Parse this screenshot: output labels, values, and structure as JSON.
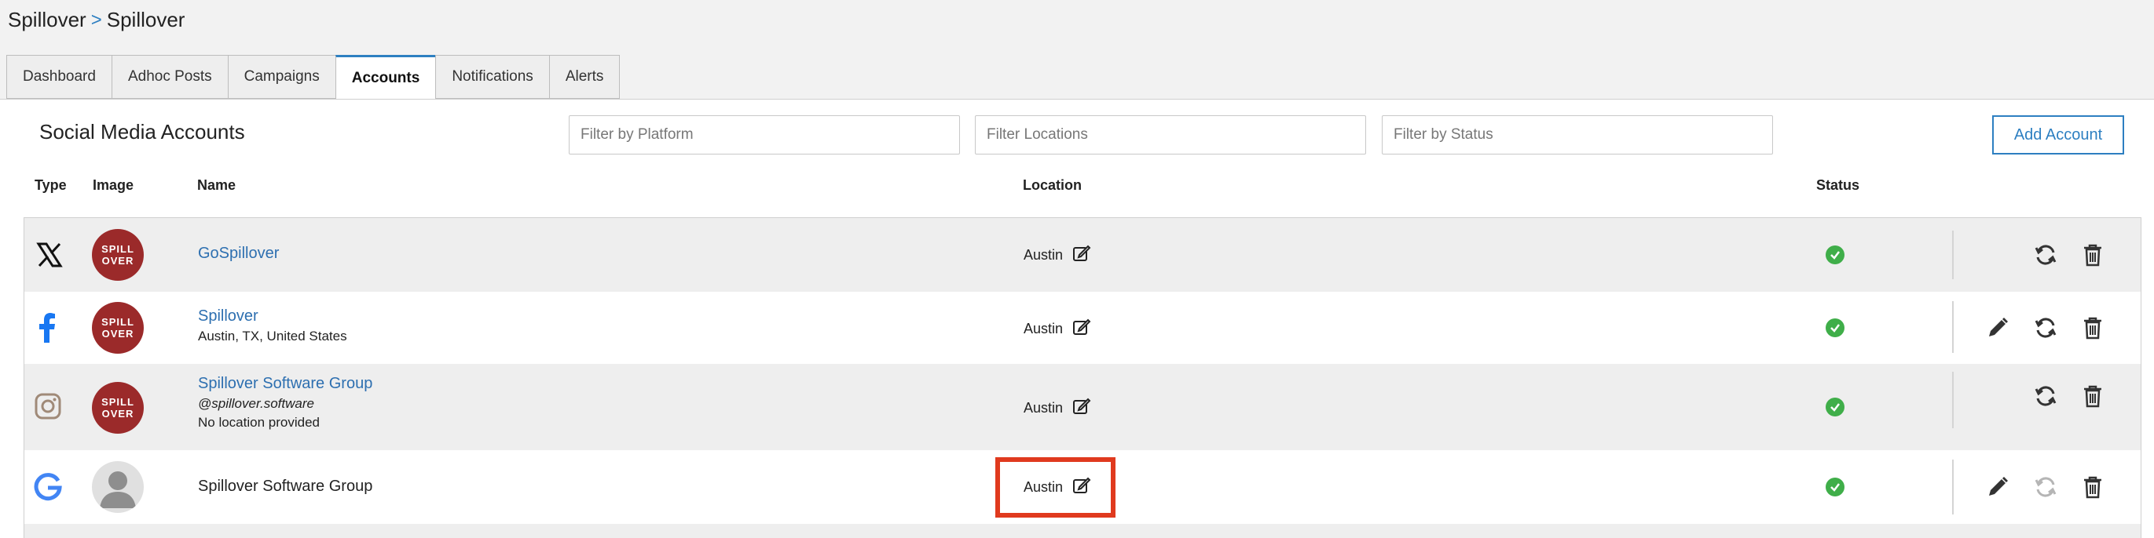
{
  "breadcrumb": {
    "parent": "Spillover",
    "separator": ">",
    "current": "Spillover"
  },
  "tabs": [
    {
      "label": "Dashboard",
      "active": false
    },
    {
      "label": "Adhoc Posts",
      "active": false
    },
    {
      "label": "Campaigns",
      "active": false
    },
    {
      "label": "Accounts",
      "active": true
    },
    {
      "label": "Notifications",
      "active": false
    },
    {
      "label": "Alerts",
      "active": false
    }
  ],
  "panel": {
    "title": "Social Media Accounts",
    "filters": {
      "platform_placeholder": "Filter by Platform",
      "locations_placeholder": "Filter Locations",
      "status_placeholder": "Filter by Status"
    },
    "add_button": "Add Account"
  },
  "table": {
    "headers": {
      "type": "Type",
      "image": "Image",
      "name": "Name",
      "location": "Location",
      "status": "Status"
    },
    "rows": [
      {
        "type_icon": "x-twitter-icon",
        "avatar": "spillover-logo",
        "avatar_text_1": "SPILL",
        "avatar_text_2": "OVER",
        "name": "GoSpillover",
        "line2": "",
        "line3": "",
        "location": "Austin",
        "status": "ok",
        "actions": [
          "refresh",
          "delete"
        ]
      },
      {
        "type_icon": "facebook-icon",
        "avatar": "spillover-logo",
        "avatar_text_1": "SPILL",
        "avatar_text_2": "OVER",
        "name": "Spillover",
        "line2": "Austin, TX, United States",
        "line3": "",
        "location": "Austin",
        "status": "ok",
        "actions": [
          "edit",
          "refresh",
          "delete"
        ]
      },
      {
        "type_icon": "instagram-icon",
        "avatar": "spillover-logo",
        "avatar_text_1": "SPILL",
        "avatar_text_2": "OVER",
        "name": "Spillover Software Group",
        "line2": "@spillover.software",
        "line3": "No location provided",
        "location": "Austin",
        "status": "ok",
        "actions": [
          "refresh",
          "delete"
        ]
      },
      {
        "type_icon": "google-icon",
        "avatar": "generic-user",
        "name": "Spillover Software Group",
        "line2": "",
        "line3": "",
        "location": "Austin",
        "status": "ok",
        "actions": [
          "edit",
          "refresh-disabled",
          "delete"
        ]
      }
    ]
  },
  "colors": {
    "accent": "#2d7fc1",
    "status_ok": "#3fae49",
    "highlight": "#e03a1e",
    "brand_avatar": "#9b2a2a"
  }
}
